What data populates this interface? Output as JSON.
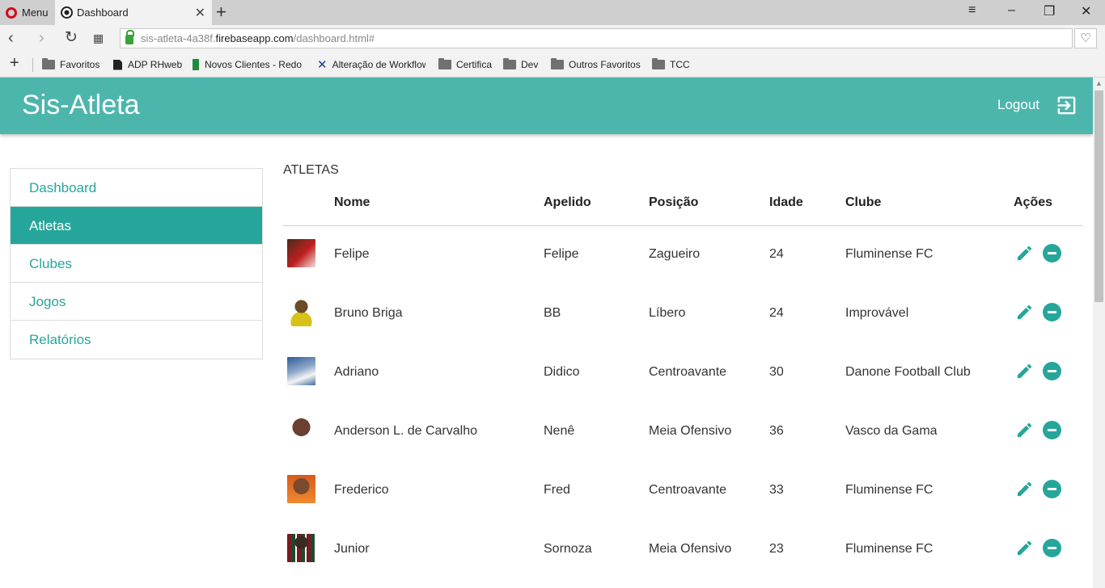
{
  "browser": {
    "menu_label": "Menu",
    "tab_title": "Dashboard",
    "url_prefix": "sis-atleta-4a38f.",
    "url_host": "firebaseapp.com",
    "url_path": "/dashboard.html#",
    "bookmarks": [
      "Favoritos",
      "ADP RHweb",
      "Novos Clientes - Redo",
      "Alteração de Workflow",
      "Certifica",
      "Dev",
      "Outros Favoritos",
      "TCC"
    ]
  },
  "app": {
    "title": "Sis-Atleta",
    "logout_label": "Logout",
    "accent_color": "#26a69a",
    "header_color": "#4db6ac"
  },
  "sidebar": {
    "items": [
      {
        "label": "Dashboard"
      },
      {
        "label": "Atletas"
      },
      {
        "label": "Clubes"
      },
      {
        "label": "Jogos"
      },
      {
        "label": "Relatórios"
      }
    ],
    "active": "Atletas"
  },
  "main": {
    "section_title": "ATLETAS",
    "columns": {
      "nome": "Nome",
      "apelido": "Apelido",
      "posicao": "Posição",
      "idade": "Idade",
      "clube": "Clube",
      "acoes": "Ações"
    },
    "rows": [
      {
        "nome": "Felipe",
        "apelido": "Felipe",
        "posicao": "Zagueiro",
        "idade": "24",
        "clube": "Fluminense FC"
      },
      {
        "nome": "Bruno Briga",
        "apelido": "BB",
        "posicao": "Líbero",
        "idade": "24",
        "clube": "Improvável"
      },
      {
        "nome": "Adriano",
        "apelido": "Didico",
        "posicao": "Centroavante",
        "idade": "30",
        "clube": "Danone Football Club"
      },
      {
        "nome": "Anderson L. de Carvalho",
        "apelido": "Nenê",
        "posicao": "Meia Ofensivo",
        "idade": "36",
        "clube": "Vasco da Gama"
      },
      {
        "nome": "Frederico",
        "apelido": "Fred",
        "posicao": "Centroavante",
        "idade": "33",
        "clube": "Fluminense FC"
      },
      {
        "nome": "Junior",
        "apelido": "Sornoza",
        "posicao": "Meia Ofensivo",
        "idade": "23",
        "clube": "Fluminense FC"
      }
    ]
  }
}
